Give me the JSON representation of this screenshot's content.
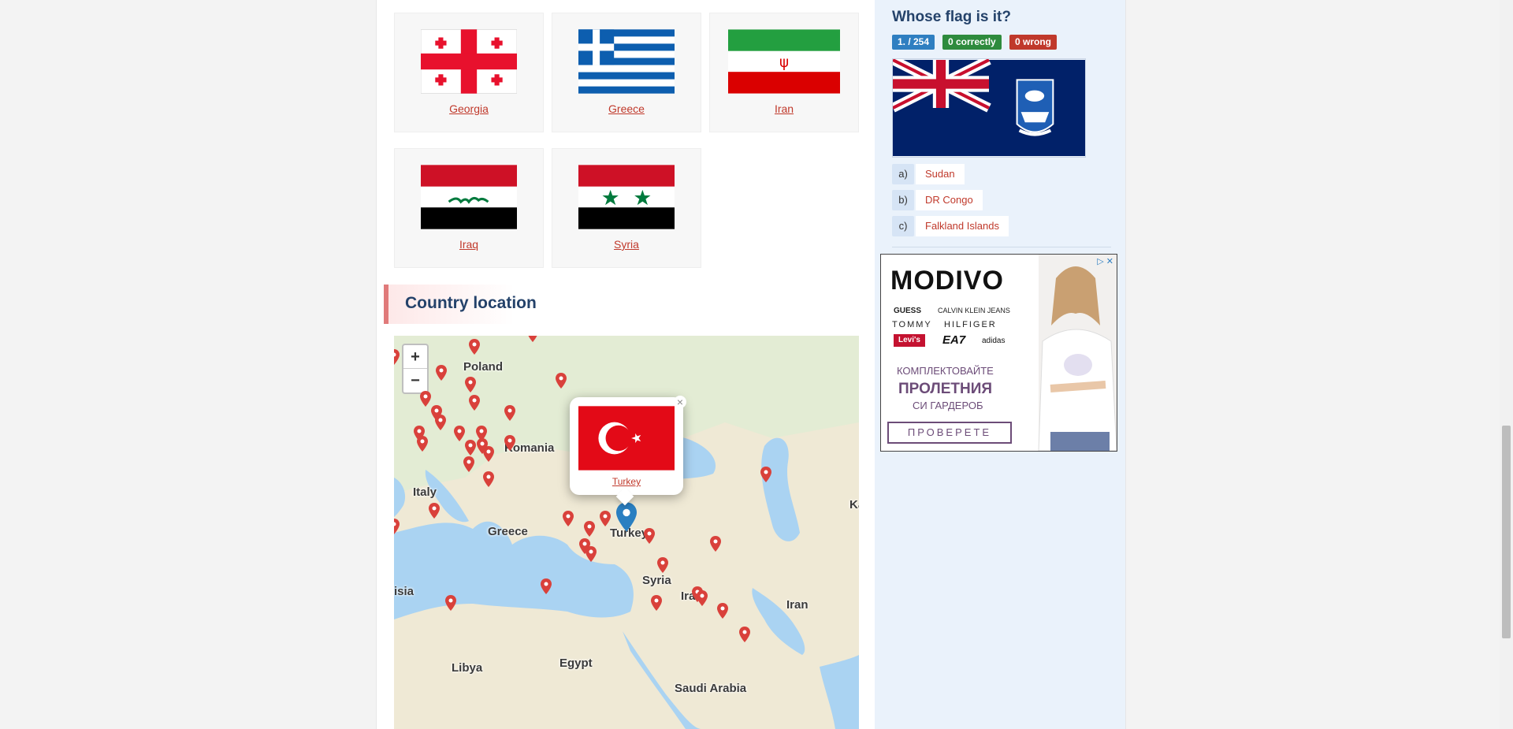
{
  "flags": [
    {
      "name": "Georgia"
    },
    {
      "name": "Greece"
    },
    {
      "name": "Iran"
    },
    {
      "name": "Iraq"
    },
    {
      "name": "Syria"
    }
  ],
  "location_section": {
    "title": "Country location"
  },
  "map": {
    "zoom_in": "+",
    "zoom_out": "−",
    "labels": [
      "Poland",
      "Romania",
      "Italy",
      "Greece",
      "Turkey",
      "Syria",
      "Iraq",
      "Iran",
      "Egypt",
      "Libya",
      "Saudi Arabia",
      "isia",
      "Ka"
    ],
    "popup": {
      "country": "Turkey",
      "close": "×"
    }
  },
  "quiz": {
    "title": "Whose flag is it?",
    "progress": "1. / 254",
    "correct": "0 correctly",
    "wrong": "0 wrong",
    "answers": [
      {
        "letter": "a)",
        "text": "Sudan"
      },
      {
        "letter": "b)",
        "text": "DR Congo"
      },
      {
        "letter": "c)",
        "text": "Falkland Islands"
      }
    ]
  },
  "ad": {
    "brand": "MODIVO",
    "logos": [
      "GUESS",
      "CALVIN KLEIN JEANS",
      "TOMMY",
      "HILFIGER",
      "Levi's",
      "EA7",
      "adidas"
    ],
    "line1": "КОМПЛЕКТОВАЙТЕ",
    "line2": "ПРОЛЕТНИЯ",
    "line3": "СИ ГАРДЕРОБ",
    "cta": "ПРОВЕРЕТЕ"
  },
  "colors": {
    "link": "#c0392b",
    "heading": "#24426a",
    "badge_blue": "#2f7fc1",
    "badge_green": "#2e8b3d",
    "badge_red": "#c0392b",
    "sidebar_bg": "#eaf2fb",
    "marker_red": "#d9413b",
    "marker_blue": "#2a7fc1"
  }
}
